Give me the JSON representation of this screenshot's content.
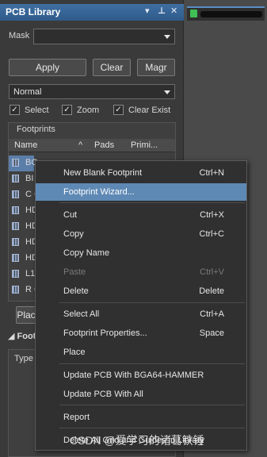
{
  "panel": {
    "title": "PCB Library",
    "mask_label": "Mask",
    "mask_value": "",
    "apply_label": "Apply",
    "clear_label": "Clear",
    "magnify_label": "Magr",
    "mode_value": "Normal",
    "select_label": "Select",
    "zoom_label": "Zoom",
    "clear_exist_label": "Clear Exist",
    "footprints_header": "Footprints",
    "columns": [
      "Name",
      "Pads",
      "Primi..."
    ],
    "rows": [
      "BGA64-HAMM",
      "BI",
      "C C",
      "HD",
      "HD",
      "HD",
      "HD",
      "L1",
      "R C"
    ],
    "selected_row_prefix": "BG",
    "place_label": "Plac",
    "footprint_primitives_label": "Foot",
    "type_column": "Type"
  },
  "menu": [
    {
      "label": "New Blank Footprint",
      "shortcut": "Ctrl+N",
      "state": "normal"
    },
    {
      "label": "Footprint Wizard...",
      "shortcut": "",
      "state": "highlighted"
    },
    {
      "label": "Cut",
      "shortcut": "Ctrl+X",
      "state": "normal"
    },
    {
      "label": "Copy",
      "shortcut": "Ctrl+C",
      "state": "normal"
    },
    {
      "label": "Copy Name",
      "shortcut": "",
      "state": "normal"
    },
    {
      "label": "Paste",
      "shortcut": "Ctrl+V",
      "state": "disabled"
    },
    {
      "label": "Delete",
      "shortcut": "Delete",
      "state": "normal"
    },
    {
      "label": "Select All",
      "shortcut": "Ctrl+A",
      "state": "normal"
    },
    {
      "label": "Footprint Properties...",
      "shortcut": "Space",
      "state": "normal"
    },
    {
      "label": "Place",
      "shortcut": "",
      "state": "normal"
    },
    {
      "label": "Update PCB With BGA64-HAMMER",
      "shortcut": "",
      "state": "normal"
    },
    {
      "label": "Update PCB With All",
      "shortcut": "",
      "state": "normal"
    },
    {
      "label": "Report",
      "shortcut": "",
      "state": "normal"
    },
    {
      "label": "Delete All Grid and Guides in Library",
      "shortcut": "",
      "state": "normal"
    }
  ],
  "watermark": "CSDN @爱学习的诸葛铁锤",
  "colors": {
    "accent": "#5f89b5",
    "title_bar": "#2f5b8b"
  }
}
